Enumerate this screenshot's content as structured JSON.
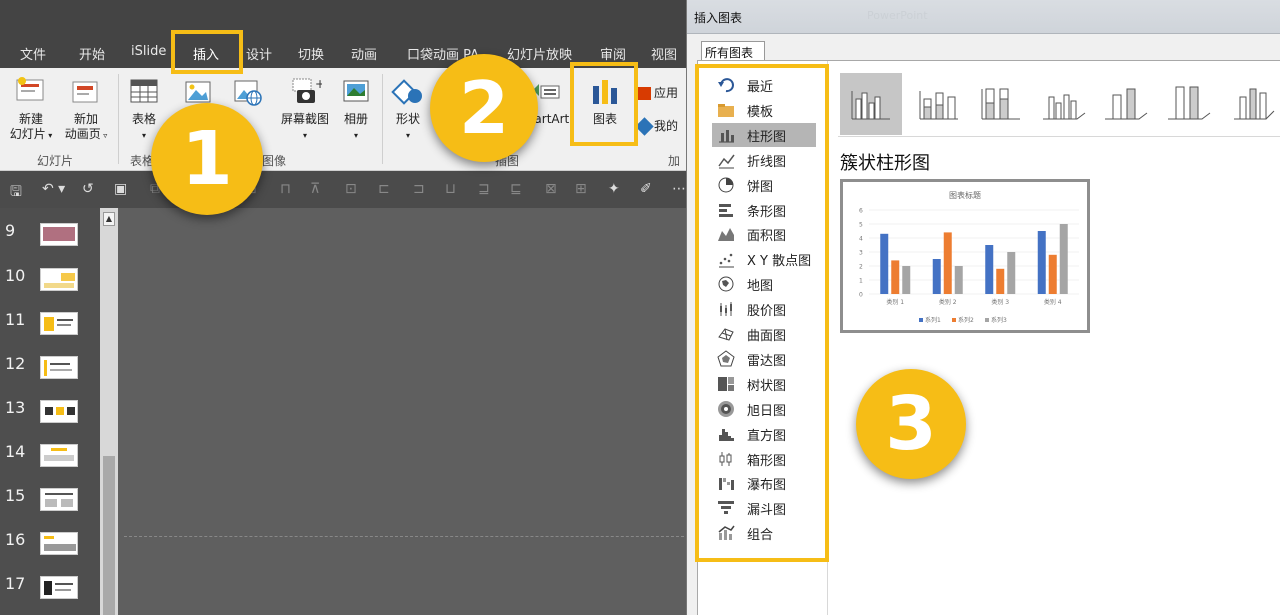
{
  "ribbon": {
    "tabs": [
      "文件",
      "开始",
      "iSlide",
      "插入",
      "设计",
      "切换",
      "动画",
      "口袋动画 PA",
      "幻灯片放映",
      "审阅",
      "视图"
    ],
    "active_tab": "插入",
    "buttons": {
      "new_slide": [
        "新建",
        "幻灯片"
      ],
      "new_anim_page": [
        "新加",
        "动画页"
      ],
      "table": "表格",
      "picture": "图片",
      "screenshot": "屏幕截图",
      "album": "相册",
      "shapes": "形状",
      "smartart": "martArt",
      "chart": "图表",
      "apps": "应用",
      "my": "我的"
    },
    "groups": {
      "slides": "幻灯片",
      "tables": "表格",
      "images": "图像",
      "illustrations": "插图",
      "addins": "加"
    }
  },
  "slides_panel": {
    "numbers": [
      "9",
      "10",
      "11",
      "12",
      "13",
      "14",
      "15",
      "16",
      "17"
    ]
  },
  "steps": [
    "1",
    "2",
    "3"
  ],
  "dialog": {
    "title": "插入图表",
    "title_ghost": "PowerPoint",
    "tab": "所有图表",
    "categories": [
      {
        "label": "最近",
        "icon": "recent-icon"
      },
      {
        "label": "模板",
        "icon": "folder-icon"
      },
      {
        "label": "柱形图",
        "icon": "column-chart-icon",
        "selected": true
      },
      {
        "label": "折线图",
        "icon": "line-chart-icon"
      },
      {
        "label": "饼图",
        "icon": "pie-chart-icon"
      },
      {
        "label": "条形图",
        "icon": "bar-chart-icon"
      },
      {
        "label": "面积图",
        "icon": "area-chart-icon"
      },
      {
        "label": "X Y 散点图",
        "icon": "scatter-chart-icon"
      },
      {
        "label": "地图",
        "icon": "map-chart-icon"
      },
      {
        "label": "股价图",
        "icon": "stock-chart-icon"
      },
      {
        "label": "曲面图",
        "icon": "surface-chart-icon"
      },
      {
        "label": "雷达图",
        "icon": "radar-chart-icon"
      },
      {
        "label": "树状图",
        "icon": "treemap-chart-icon"
      },
      {
        "label": "旭日图",
        "icon": "sunburst-chart-icon"
      },
      {
        "label": "直方图",
        "icon": "histogram-chart-icon"
      },
      {
        "label": "箱形图",
        "icon": "box-chart-icon"
      },
      {
        "label": "瀑布图",
        "icon": "waterfall-chart-icon"
      },
      {
        "label": "漏斗图",
        "icon": "funnel-chart-icon"
      },
      {
        "label": "组合",
        "icon": "combo-chart-icon"
      }
    ],
    "selected_type_name": "簇状柱形图",
    "preview": {
      "title": "图表标题",
      "categories": [
        "类别 1",
        "类别 2",
        "类别 3",
        "类别 4"
      ],
      "series": [
        {
          "name": "系列1",
          "values": [
            4.3,
            2.5,
            3.5,
            4.5
          ]
        },
        {
          "name": "系列2",
          "values": [
            2.4,
            4.4,
            1.8,
            2.8
          ]
        },
        {
          "name": "系列3",
          "values": [
            2.0,
            2.0,
            3.0,
            5.0
          ]
        }
      ],
      "yticks": [
        "0",
        "1",
        "2",
        "3",
        "4",
        "5",
        "6"
      ],
      "ymax": 6
    },
    "colors": {
      "series1": "#4472c4",
      "series2": "#ed7d31",
      "series3": "#a5a5a5",
      "badge": "#f6bd16"
    }
  }
}
